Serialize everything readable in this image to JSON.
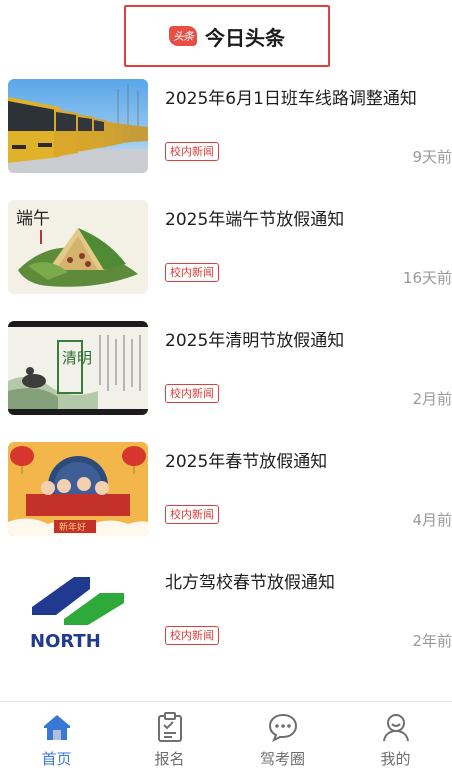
{
  "header": {
    "logo_text": "头条",
    "title": "今日头条"
  },
  "news": [
    {
      "title": "2025年6月1日班车线路调整通知",
      "tag": "校内新闻",
      "time": "9天前",
      "thumb": "buses-photo"
    },
    {
      "title": "2025年端午节放假通知",
      "tag": "校内新闻",
      "time": "16天前",
      "thumb": "dragon-boat-festival",
      "thumb_text": "端午"
    },
    {
      "title": "2025年清明节放假通知",
      "tag": "校内新闻",
      "time": "2月前",
      "thumb": "qingming-festival",
      "thumb_text": "清明"
    },
    {
      "title": "2025年春节放假通知",
      "tag": "校内新闻",
      "time": "4月前",
      "thumb": "spring-festival",
      "thumb_text": "新年好"
    },
    {
      "title": "北方驾校春节放假通知",
      "tag": "校内新闻",
      "time": "2年前",
      "thumb": "north-logo",
      "thumb_text": "NORTH"
    }
  ],
  "tabbar": {
    "items": [
      {
        "label": "首页",
        "icon": "home-icon",
        "active": true
      },
      {
        "label": "报名",
        "icon": "clipboard-icon",
        "active": false
      },
      {
        "label": "驾考圈",
        "icon": "chat-bubble-icon",
        "active": false
      },
      {
        "label": "我的",
        "icon": "user-icon",
        "active": false
      }
    ]
  },
  "colors": {
    "accent_red": "#d9423c",
    "active_blue": "#3a78d6",
    "muted_text": "#9a9a9a"
  }
}
